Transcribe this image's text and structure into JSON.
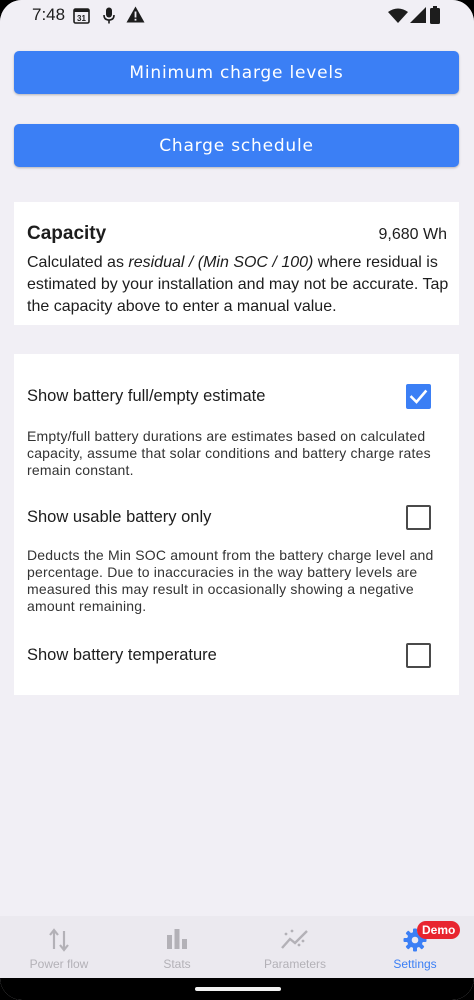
{
  "status_bar": {
    "time": "7:48",
    "calendar_day": "31"
  },
  "buttons": {
    "min_charge": "Minimum charge levels",
    "charge_schedule": "Charge schedule"
  },
  "capacity": {
    "title": "Capacity",
    "value": "9,680 Wh",
    "desc_prefix": "Calculated as ",
    "desc_formula": "residual / (Min SOC / 100)",
    "desc_suffix": " where residual is estimated by your installation and may not be accurate. Tap the capacity above to enter a manual value."
  },
  "settings": [
    {
      "label": "Show battery full/empty estimate",
      "checked": true,
      "description": "Empty/full battery durations are estimates based on calculated capacity, assume that solar conditions and battery charge rates remain constant."
    },
    {
      "label": "Show usable battery only",
      "checked": false,
      "description": "Deducts the Min SOC amount from the battery charge level and percentage. Due to inaccuracies in the way battery levels are measured this may result in occasionally showing a negative amount remaining."
    },
    {
      "label": "Show battery temperature",
      "checked": false
    }
  ],
  "nav": {
    "items": [
      {
        "label": "Power flow",
        "icon": "power-flow-icon"
      },
      {
        "label": "Stats",
        "icon": "stats-icon"
      },
      {
        "label": "Parameters",
        "icon": "parameters-icon"
      },
      {
        "label": "Settings",
        "icon": "gear-icon",
        "active": true
      }
    ],
    "badge": "Demo"
  },
  "colors": {
    "accent": "#3b7ff5",
    "background": "#f1eff5",
    "badge": "#e8252f",
    "nav_inactive": "#b3b1b7"
  }
}
